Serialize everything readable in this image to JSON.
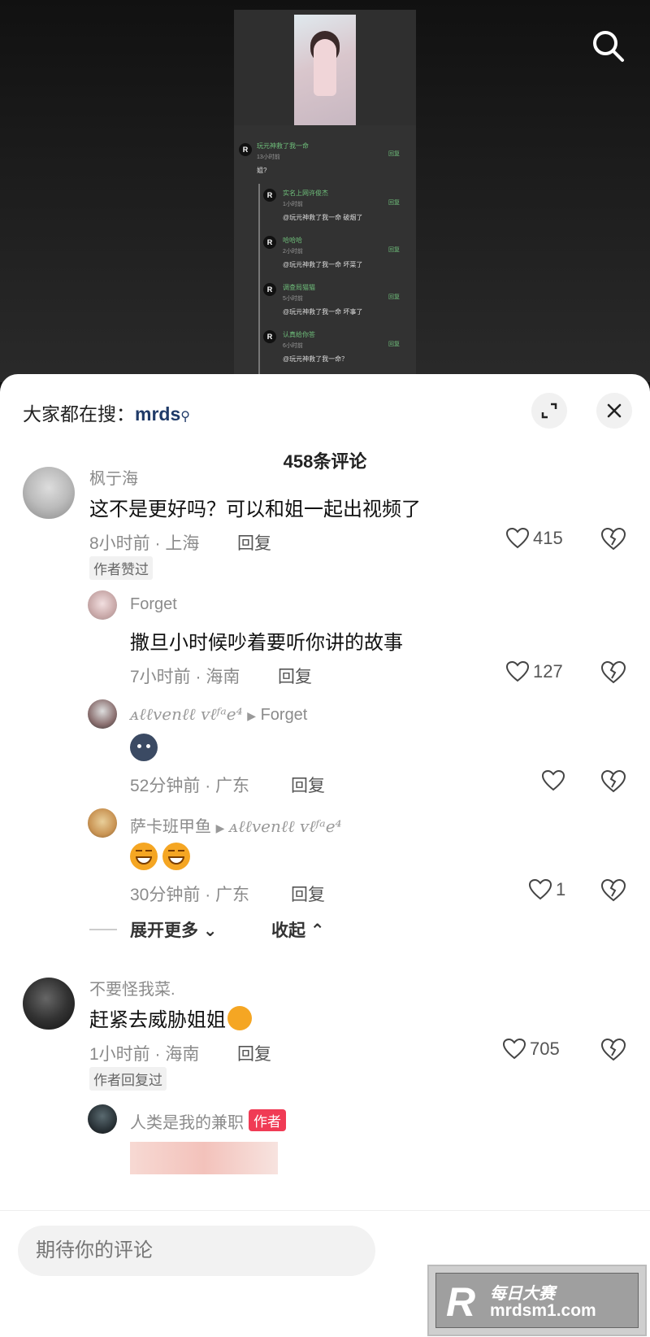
{
  "hot_search": {
    "prefix": "大家都在搜：",
    "keyword": "mrds"
  },
  "comment_count": "458条评论",
  "embedded_thread": {
    "top": {
      "name": "玩元神救了我一命",
      "time": "13小时前",
      "text": "姐?",
      "reply": "回复"
    },
    "replies": [
      {
        "name": "实名上网许俊杰",
        "time": "1小时前",
        "text": "@玩元神救了我一命 破烟了",
        "reply": "回复"
      },
      {
        "name": "哈哈哈",
        "time": "2小时前",
        "text": "@玩元神救了我一命 坏菜了",
        "reply": "回复"
      },
      {
        "name": "调查局猫猫",
        "time": "5小时前",
        "text": "@玩元神救了我一命 坏事了",
        "reply": "回复"
      },
      {
        "name": "认真给你答",
        "time": "6小时前",
        "text": "@玩元神救了我一命？",
        "reply": "回复"
      }
    ]
  },
  "comments": {
    "c1": {
      "user": "枫亍海",
      "text": "这不是更好吗？可以和姐一起出视频了",
      "meta": "8小时前 · 上海",
      "reply": "回复",
      "likes": "415",
      "tag": "作者赞过"
    },
    "r1": {
      "user": "Forget",
      "text": "撒旦小时候吵着要听你讲的故事",
      "meta": "7小时前 · 海南",
      "reply": "回复",
      "likes": "127"
    },
    "r2": {
      "user": "ᴀℓℓvenℓℓ ᴠℓᶠᵃe⁴",
      "target": "Forget",
      "text": "",
      "meta": "52分钟前 · 广东",
      "reply": "回复",
      "likes": ""
    },
    "r3": {
      "user": "萨卡班甲鱼",
      "target": "ᴀℓℓvenℓℓ ᴠℓᶠᵃe⁴",
      "text": "",
      "meta": "30分钟前 · 广东",
      "reply": "回复",
      "likes": "1"
    },
    "expand_more": "展开更多",
    "collapse": "收起",
    "c2": {
      "user": "不要怪我菜.",
      "text": "赶紧去威胁姐姐",
      "meta": "1小时前 · 海南",
      "reply": "回复",
      "likes": "705",
      "tag": "作者回复过"
    },
    "r4": {
      "user": "人类是我的兼职",
      "badge": "作者"
    }
  },
  "input_placeholder": "期待你的评论",
  "watermark": {
    "logo": "R",
    "line1": "每日大赛",
    "line2": "mrdsm1.com"
  },
  "icons": [
    "search-icon",
    "expand-icon",
    "close-icon",
    "heart-icon",
    "broken-heart-icon",
    "chevron-down-icon",
    "chevron-up-icon"
  ],
  "colors": {
    "accent": "#1f3a68",
    "author_badge": "#f03b55",
    "sheet_bg": "#ffffff"
  }
}
